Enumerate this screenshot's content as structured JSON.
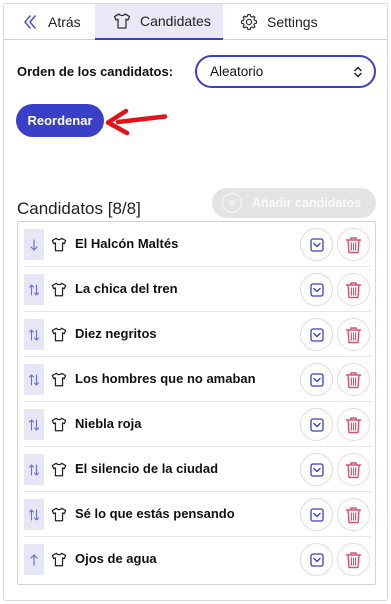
{
  "tabs": [
    {
      "label": "Atrás",
      "icon": "chevron-double-left-icon"
    },
    {
      "label": "Candidates",
      "icon": "shirt-icon"
    },
    {
      "label": "Settings",
      "icon": "gear-icon"
    }
  ],
  "order": {
    "label": "Orden de los candidatos:",
    "selected": "Aleatorio"
  },
  "reorder_button": "Reordenar",
  "candidates_section": {
    "title": "Candidatos [8/8]",
    "add_button": "Añadir candidatos",
    "items": [
      {
        "name": "El Halcón Maltés",
        "handle": "down"
      },
      {
        "name": "La chica del tren",
        "handle": "updown"
      },
      {
        "name": "Diez negritos",
        "handle": "updown"
      },
      {
        "name": "Los hombres que no amaban",
        "handle": "updown"
      },
      {
        "name": "Niebla roja",
        "handle": "updown"
      },
      {
        "name": "El silencio de la ciudad",
        "handle": "updown"
      },
      {
        "name": "Sé lo que estás pensando",
        "handle": "updown"
      },
      {
        "name": "Ojos de agua",
        "handle": "up"
      }
    ]
  },
  "colors": {
    "accent": "#3a3fc8",
    "accent_light": "#e8e8f7",
    "delete": "#d8536f",
    "annotation_arrow": "#e3121b"
  }
}
